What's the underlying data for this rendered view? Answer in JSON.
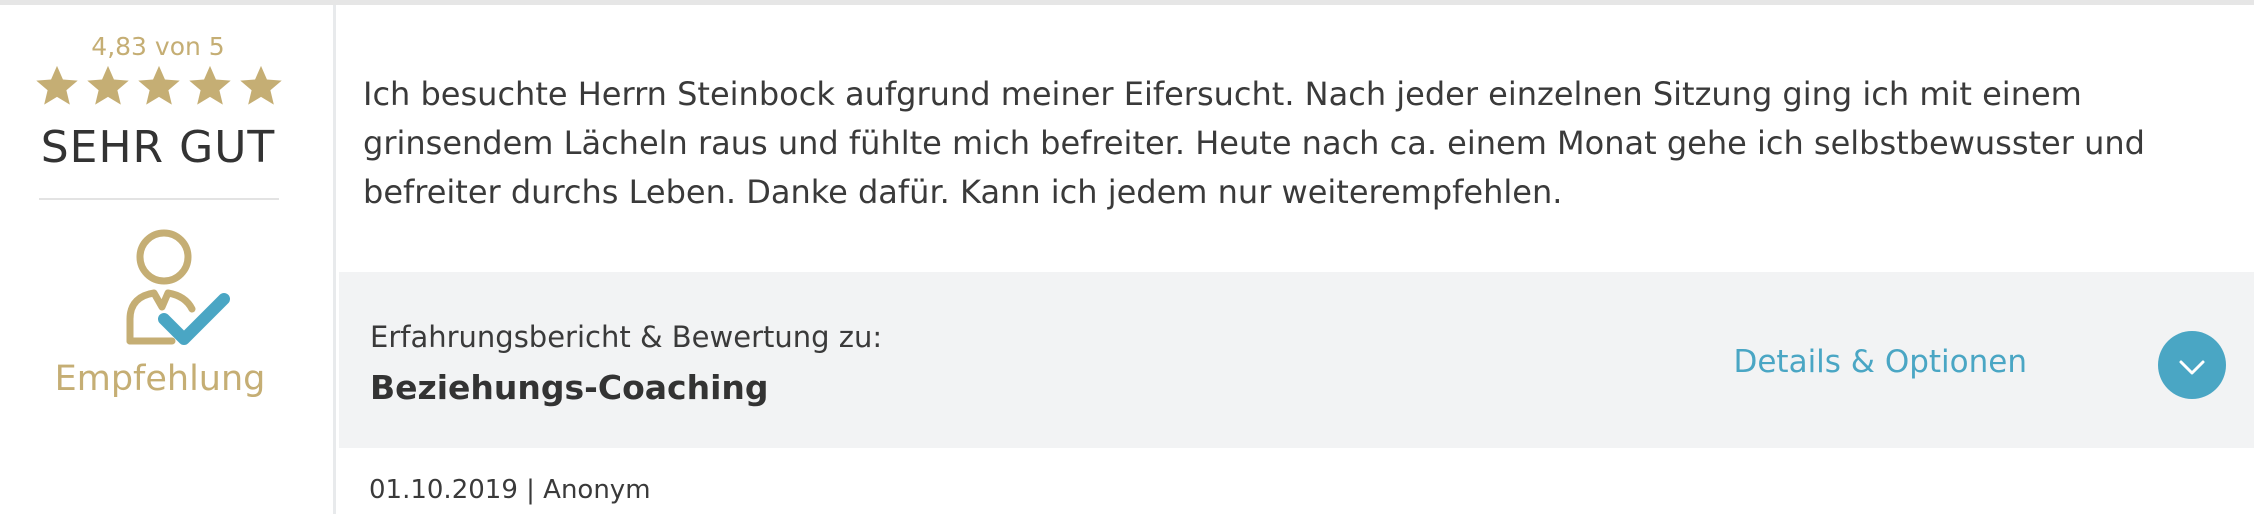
{
  "rating": {
    "score_text": "4,83 von 5",
    "stars_filled": 5,
    "stars_total": 5,
    "label": "SEHR GUT",
    "recommendation_label": "Empfehlung",
    "icon": "person-check-icon",
    "star_icon": "star-icon",
    "gold_color": "#c5ae74",
    "check_color": "#4aa6c4"
  },
  "review": {
    "text": "Ich besuchte Herrn Steinbock aufgrund meiner Eifersucht. Nach jeder einzelnen Sitzung ging ich mit einem grinsendem Lächeln raus und fühlte mich befreiter. Heute nach ca. einem Monat gehe ich selbstbewusster und befreiter durchs Leben. Danke dafür. Kann ich jedem nur weiterempfehlen."
  },
  "info": {
    "label": "Erfahrungsbericht & Bewertung zu:",
    "title": "Beziehungs-Coaching",
    "details_link": "Details & Optionen",
    "details_icon": "chevron-down-icon",
    "accent_color": "#4aa6c4"
  },
  "meta": {
    "text": "01.10.2019 | Anonym"
  }
}
